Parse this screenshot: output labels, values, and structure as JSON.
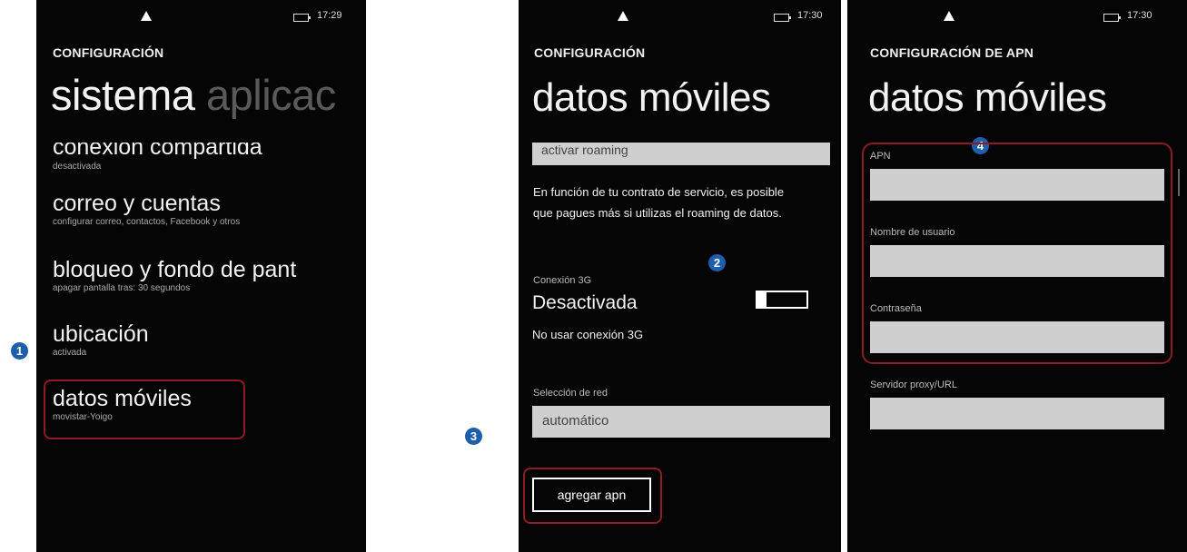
{
  "markers": [
    "1",
    "2",
    "3",
    "4"
  ],
  "screen1": {
    "time": "17:29",
    "kicker": "CONFIGURACIÓN",
    "pivot_active": "sistema",
    "pivot_next": "aplicac",
    "items": [
      {
        "title": "conexión compartida",
        "subtitle": "desactivada"
      },
      {
        "title": "correo y cuentas",
        "subtitle": "configurar correo, contactos, Facebook y otros"
      },
      {
        "title": "bloqueo y fondo de pant",
        "subtitle": "apagar pantalla tras: 30 segundos"
      },
      {
        "title": "ubicación",
        "subtitle": "activada"
      },
      {
        "title": "datos móviles",
        "subtitle": "movistar-Yoigo"
      }
    ]
  },
  "screen2": {
    "time": "17:30",
    "kicker": "CONFIGURACIÓN",
    "title": "datos móviles",
    "roaming_field": "activar roaming",
    "roaming_note": "En función de tu contrato de servicio, es posible que pagues más si utilizas el roaming de datos.",
    "conn3g_label": "Conexión 3G",
    "conn3g_state": "Desactivada",
    "conn3g_desc": "No usar conexión 3G",
    "network_label": "Selección de red",
    "network_value": "automático",
    "add_apn_button": "agregar apn",
    "toggle_on": false
  },
  "screen3": {
    "time": "17:30",
    "kicker": "CONFIGURACIÓN DE APN",
    "title": "datos móviles",
    "fields": [
      {
        "label": "APN",
        "value": ""
      },
      {
        "label": "Nombre de usuario",
        "value": ""
      },
      {
        "label": "Contraseña",
        "value": ""
      },
      {
        "label": "Servidor proxy/URL",
        "value": ""
      }
    ]
  },
  "colors": {
    "highlight": "#8f1b24",
    "marker": "#1f5eaa",
    "field": "#cfcfcf"
  }
}
